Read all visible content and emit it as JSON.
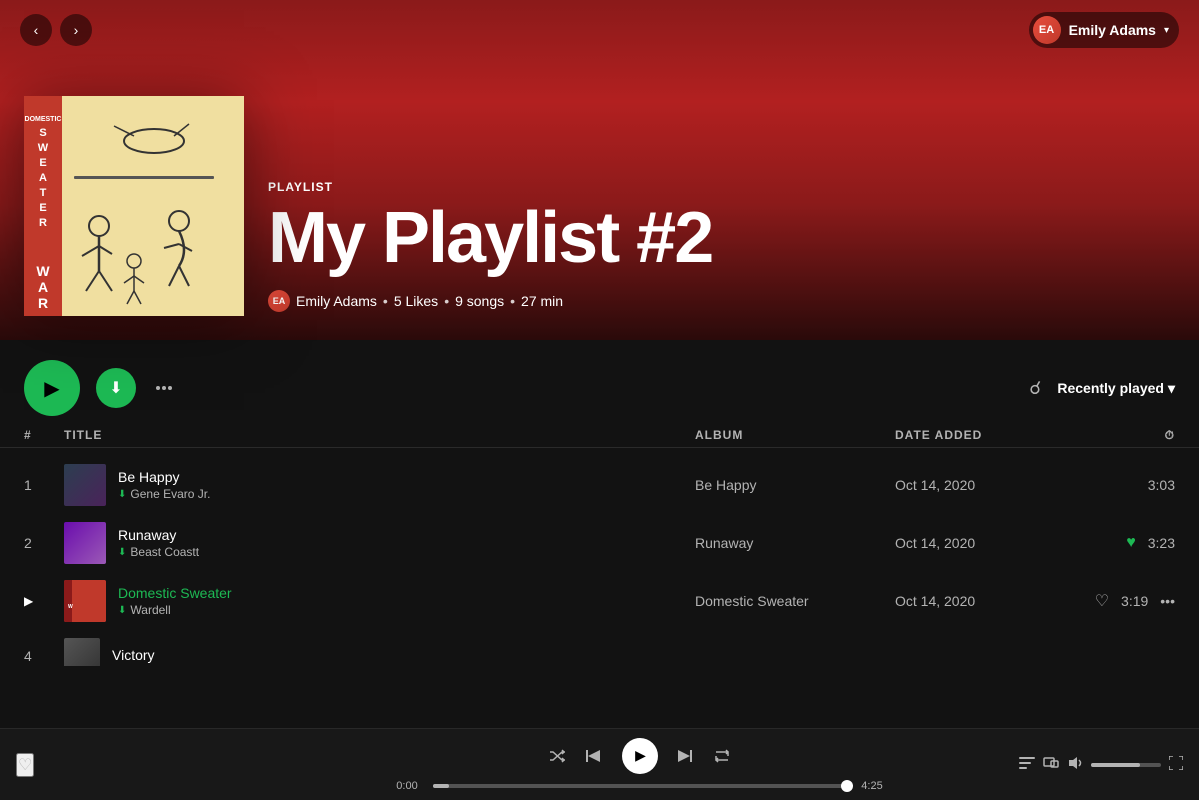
{
  "nav": {
    "back_label": "‹",
    "forward_label": "›"
  },
  "user": {
    "name": "Emily Adams",
    "chevron": "▾"
  },
  "playlist": {
    "type_label": "PLAYLIST",
    "title": "My Playlist #2",
    "owner": "Emily Adams",
    "likes": "5 Likes",
    "songs": "9 songs",
    "duration": "27 min"
  },
  "controls": {
    "play_label": "▶",
    "recently_played_label": "Recently played",
    "recently_played_chevron": "▾"
  },
  "table_headers": {
    "num": "#",
    "title": "TITLE",
    "album": "ALBUM",
    "date_added": "DATE ADDED",
    "time_icon": "⏱"
  },
  "tracks": [
    {
      "num": "1",
      "name": "Be Happy",
      "artist": "Gene Evaro Jr.",
      "album": "Be Happy",
      "date_added": "Oct 14, 2020",
      "duration": "3:03",
      "thumb_color": "dark-purple",
      "liked": false,
      "playing": false
    },
    {
      "num": "2",
      "name": "Runaway",
      "artist": "Beast Coastt",
      "album": "Runaway",
      "date_added": "Oct 14, 2020",
      "duration": "3:23",
      "thumb_color": "purple",
      "liked": true,
      "playing": false
    },
    {
      "num": "▶",
      "name": "Domestic Sweater",
      "artist": "Wardell",
      "album": "Domestic Sweater",
      "date_added": "Oct 14, 2020",
      "duration": "3:19",
      "thumb_color": "red-art",
      "liked": false,
      "playing": true
    },
    {
      "num": "4",
      "name": "Victory",
      "artist": "",
      "album": "",
      "date_added": "",
      "duration": "",
      "thumb_color": "gray",
      "liked": false,
      "playing": false
    }
  ],
  "player": {
    "time_current": "0:00",
    "time_total": "4:25",
    "progress_percent": 4
  }
}
